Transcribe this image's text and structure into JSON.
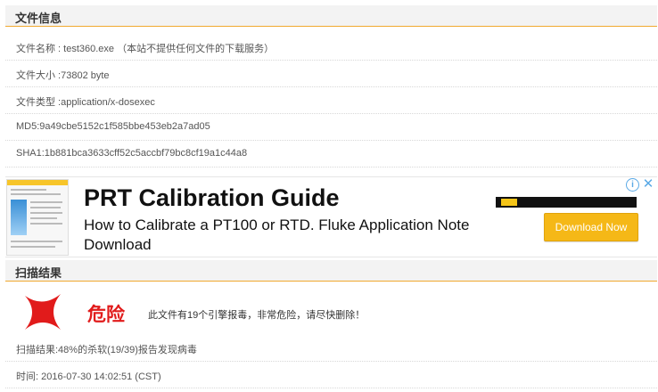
{
  "file_info": {
    "header": "文件信息",
    "rows": [
      "文件名称 : test360.exe （本站不提供任何文件的下载服务）",
      "文件大小 :73802 byte",
      "文件类型 :application/x-dosexec",
      "MD5:9a49cbe5152c1f585bbe453eb2a7ad05",
      "SHA1:1b881bca3633cff52c5accbf79bc8cf19a1c44a8"
    ]
  },
  "ad": {
    "title": "PRT Calibration Guide",
    "description": "How to Calibrate a PT100 or RTD. Fluke Application Note Download",
    "button_label": "Download Now",
    "info_symbol": "i",
    "close_symbol": "✕"
  },
  "scan": {
    "header": "扫描结果",
    "danger_label": "危险",
    "danger_message": "此文件有19个引擎报毒，非常危险，请尽快删除！",
    "result_text": "扫描结果:48%的杀软(19/39)报告发现病毒",
    "time_text": "时间: 2016-07-30 14:02:51 (CST)"
  },
  "colors": {
    "accent": "#f0a930",
    "danger": "#e11b1b",
    "button": "#f5b817"
  }
}
